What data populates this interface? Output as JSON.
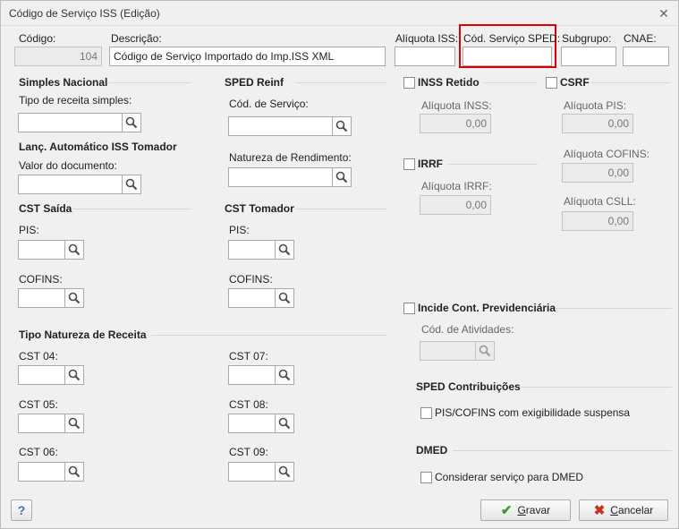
{
  "window": {
    "title": "Código de Serviço ISS (Edição)"
  },
  "header": {
    "codigo_label": "Código:",
    "codigo_value": "104",
    "descricao_label": "Descrição:",
    "descricao_value": "Código de Serviço Importado do Imp.ISS XML",
    "aliquota_iss_label": "Alíquota ISS:",
    "cod_servico_sped_label": "Cód. Serviço SPED:",
    "subgrupo_label": "Subgrupo:",
    "cnae_label": "CNAE:"
  },
  "simples_nacional": {
    "title": "Simples Nacional",
    "tipo_receita_label": "Tipo de receita simples:"
  },
  "sped_reinf": {
    "title": "SPED Reinf",
    "cod_servico_label": "Cód. de Serviço:",
    "natureza_label": "Natureza de Rendimento:"
  },
  "lanc_automatico": {
    "title": "Lanç. Automático ISS Tomador",
    "valor_label": "Valor do documento:"
  },
  "cst_saida": {
    "title": "CST Saída",
    "pis_label": "PIS:",
    "cofins_label": "COFINS:"
  },
  "cst_tomador": {
    "title": "CST Tomador",
    "pis_label": "PIS:",
    "cofins_label": "COFINS:"
  },
  "tipo_natureza": {
    "title": "Tipo Natureza de Receita",
    "cst04": "CST 04:",
    "cst05": "CST 05:",
    "cst06": "CST 06:",
    "cst07": "CST 07:",
    "cst08": "CST 08:",
    "cst09": "CST 09:"
  },
  "inss": {
    "title": "INSS Retido",
    "aliquota_label": "Alíquota INSS:",
    "aliquota_value": "0,00"
  },
  "irrf": {
    "title": "IRRF",
    "aliquota_label": "Alíquota IRRF:",
    "aliquota_value": "0,00"
  },
  "csrf": {
    "title": "CSRF",
    "pis_label": "Alíquota PIS:",
    "pis_value": "0,00",
    "cofins_label": "Alíquota COFINS:",
    "cofins_value": "0,00",
    "csll_label": "Alíquota CSLL:",
    "csll_value": "0,00"
  },
  "cont_prev": {
    "title": "Incide Cont. Previdenciária",
    "atividades_label": "Cód. de Atividades:"
  },
  "sped_contrib": {
    "title": "SPED Contribuições",
    "check_label": "PIS/COFINS com exigibilidade suspensa"
  },
  "dmed": {
    "title": "DMED",
    "check_label": "Considerar serviço para DMED"
  },
  "buttons": {
    "help": "?",
    "gravar_first": "G",
    "gravar_rest": "ravar",
    "cancelar_first": "C",
    "cancelar_rest": "ancelar"
  },
  "colors": {
    "highlight": "#e00000",
    "ok_green": "#3a9a2a",
    "cancel_red": "#c8321e"
  }
}
